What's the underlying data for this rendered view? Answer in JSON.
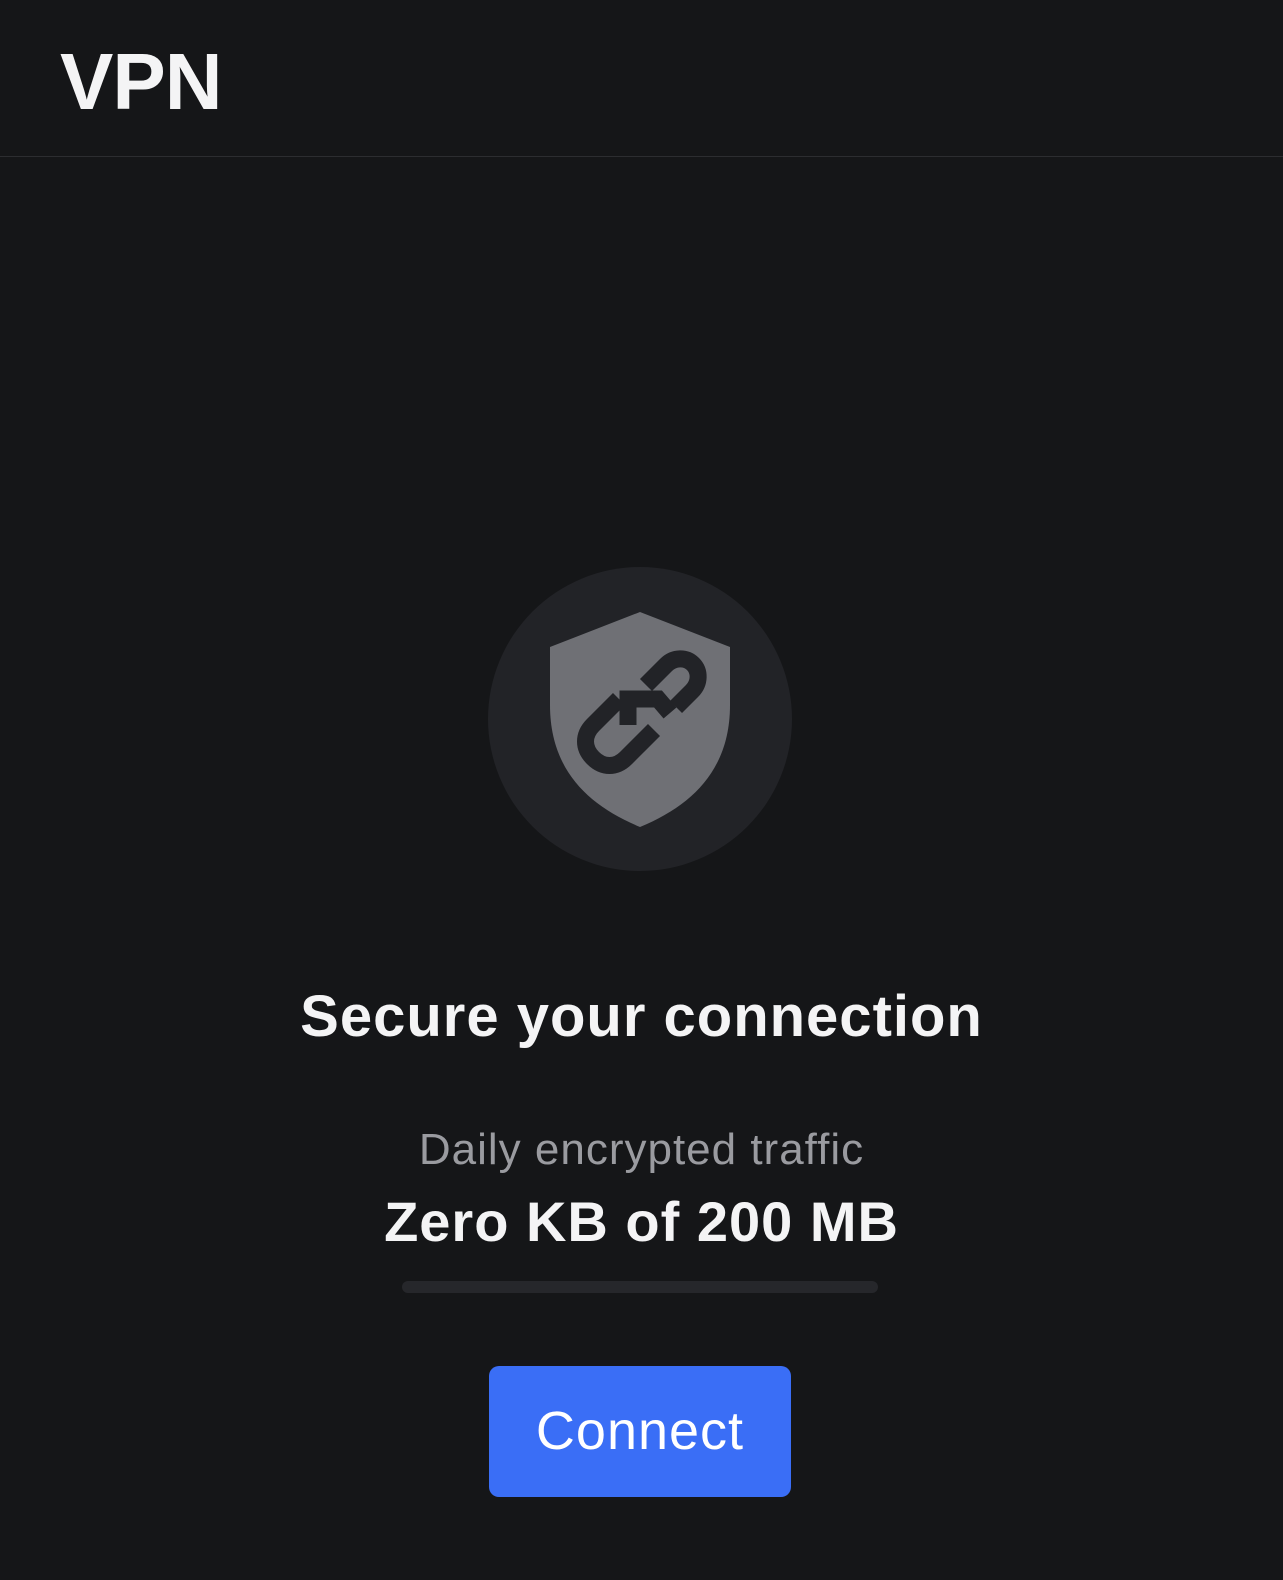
{
  "header": {
    "title": "VPN"
  },
  "status": {
    "icon": "shield-link-icon",
    "headline": "Secure your connection"
  },
  "traffic": {
    "label": "Daily encrypted traffic",
    "value_text": "Zero KB of 200 MB",
    "used_fraction": 0
  },
  "actions": {
    "connect_label": "Connect"
  },
  "colors": {
    "background": "#151618",
    "accent": "#3a6ef6",
    "icon_circle": "#222327",
    "shield": "#6f7075",
    "progress_track": "#26272b"
  }
}
